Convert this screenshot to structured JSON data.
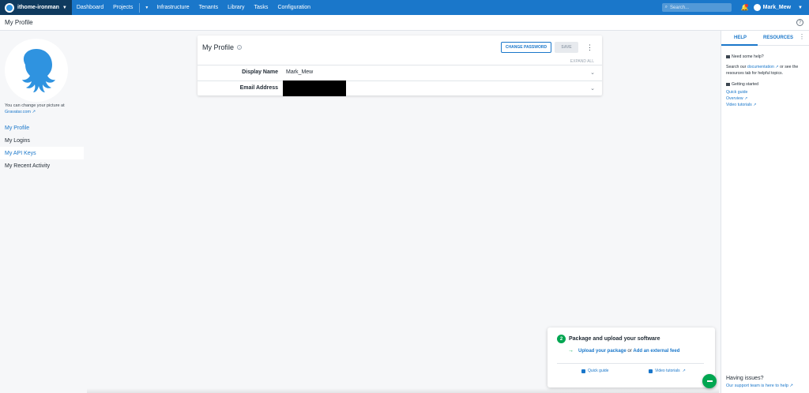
{
  "topnav": {
    "space_name": "ithome-ironman",
    "items": [
      "Dashboard",
      "Projects",
      "Infrastructure",
      "Tenants",
      "Library",
      "Tasks",
      "Configuration"
    ],
    "search_placeholder": "Search...",
    "user_name": "Mark_Mew",
    "accent_color": "#1a77ca",
    "space_bg": "#0f3a5e"
  },
  "page_header": {
    "title": "My Profile",
    "help_icon": "help-circle-icon"
  },
  "sidebar": {
    "gravatar_text": "You can change your picture at",
    "gravatar_link": "Gravatar.com",
    "items": [
      {
        "label": "My Profile"
      },
      {
        "label": "My Logins"
      },
      {
        "label": "My API Keys"
      },
      {
        "label": "My Recent Activity"
      }
    ]
  },
  "card": {
    "title": "My Profile",
    "change_password_label": "CHANGE PASSWORD",
    "save_label": "SAVE",
    "expand_all_label": "EXPAND ALL",
    "rows": [
      {
        "label": "Display Name",
        "value": "Mark_Mew"
      },
      {
        "label": "Email Address",
        "value": ""
      }
    ]
  },
  "help_panel": {
    "tabs": [
      "HELP",
      "RESOURCES"
    ],
    "need_help_title": "Need some help?",
    "search_prefix": "Search our",
    "documentation_link": "documentation",
    "search_suffix": "or see the resources tab for helpful topics.",
    "getting_started_title": "Getting started",
    "links": [
      "Quick guide",
      "Overview",
      "Video tutorials"
    ],
    "issues_title": "Having issues?",
    "issues_link": "Our support team is here to help"
  },
  "onboarding": {
    "step": "2",
    "title": "Package and upload your software",
    "action_link_1": "Upload your package",
    "action_or": "or",
    "action_link_2": "Add an external feed",
    "quick_guide": "Quick guide",
    "video_tutorials": "Video tutorials",
    "color": "#00a651"
  }
}
